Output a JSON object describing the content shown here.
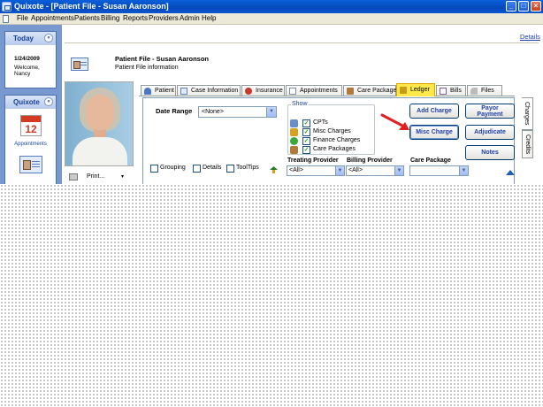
{
  "window": {
    "title": "Quixote - [Patient File - Susan Aaronson]",
    "buttons": {
      "minimize": "_",
      "restore": "□",
      "close": "×"
    }
  },
  "menu": [
    "File",
    "Appointments",
    "Patients",
    "Billing",
    "Reports",
    "Providers",
    "Admin",
    "Help"
  ],
  "sidebar": {
    "today": {
      "header": "Today",
      "date": "1/24/2009",
      "welcome": "Welcome,",
      "user": "Nancy",
      "collapse": "«"
    },
    "quixote": {
      "header": "Quixote",
      "collapse": "«",
      "calendar_number": "12",
      "appointments_label": "Appointments"
    }
  },
  "header": {
    "details_link": "Details",
    "title": "Patient File - Susan Aaronson",
    "subtitle": "Patient File information"
  },
  "print": {
    "label": "Print...",
    "arrow": "▾"
  },
  "tabs": [
    {
      "label": "Patient",
      "icon": "patient-icon",
      "color": "#4a78c8"
    },
    {
      "label": "Case Information",
      "icon": "case-icon",
      "color": "#5a7cbc"
    },
    {
      "label": "Insurance",
      "icon": "insurance-icon",
      "color": "#c83a2a"
    },
    {
      "label": "Appointments",
      "icon": "appointments-icon",
      "color": "#7a8a9a"
    },
    {
      "label": "Care Packages",
      "icon": "care-packages-icon",
      "color": "#b07a3a"
    },
    {
      "label": "Ledger",
      "icon": "ledger-icon",
      "color": "#c89a1a",
      "active": true
    },
    {
      "label": "Bills",
      "icon": "bills-icon",
      "color": "#7a5aa8"
    },
    {
      "label": "Files",
      "icon": "files-icon",
      "color": "#8a8a8a"
    }
  ],
  "ledger": {
    "date_range": {
      "label": "Date Range",
      "value": "<None>"
    },
    "show": {
      "legend": "Show",
      "items": [
        {
          "label": "CPTs",
          "checked": true,
          "icon": "cpt-icon",
          "color": "#6a8ec8"
        },
        {
          "label": "Misc Charges",
          "checked": true,
          "icon": "misc-charges-icon",
          "color": "#d8a020"
        },
        {
          "label": "Finance Charges",
          "checked": true,
          "icon": "finance-charges-icon",
          "color": "#3aa83a"
        },
        {
          "label": "Care Packages",
          "checked": true,
          "icon": "care-packages-icon",
          "color": "#b07a3a"
        }
      ]
    },
    "buttons": {
      "add_charge": "Add Charge",
      "payor_payment_1": "Payor",
      "payor_payment_2": "Payment",
      "misc_charge": "Misc Charge",
      "adjudicate": "Adjudicate",
      "notes": "Notes"
    },
    "options": {
      "grouping": "Grouping",
      "details": "Details",
      "tooltips": "ToolTips"
    },
    "filters": {
      "treating_provider": {
        "label": "Treating Provider",
        "value": "<All>"
      },
      "billing_provider": {
        "label": "Billing Provider",
        "value": "<All>"
      },
      "care_package": {
        "label": "Care Package",
        "value": ""
      }
    },
    "side_tabs": {
      "charges": "Charges",
      "credits": "Credits"
    }
  },
  "colors": {
    "titlebar": "#0649bd",
    "sidebar": "#7898d0",
    "active_tab": "#ffe84a",
    "button_text": "#1d3fa8",
    "annotation_arrow": "#e02020"
  }
}
